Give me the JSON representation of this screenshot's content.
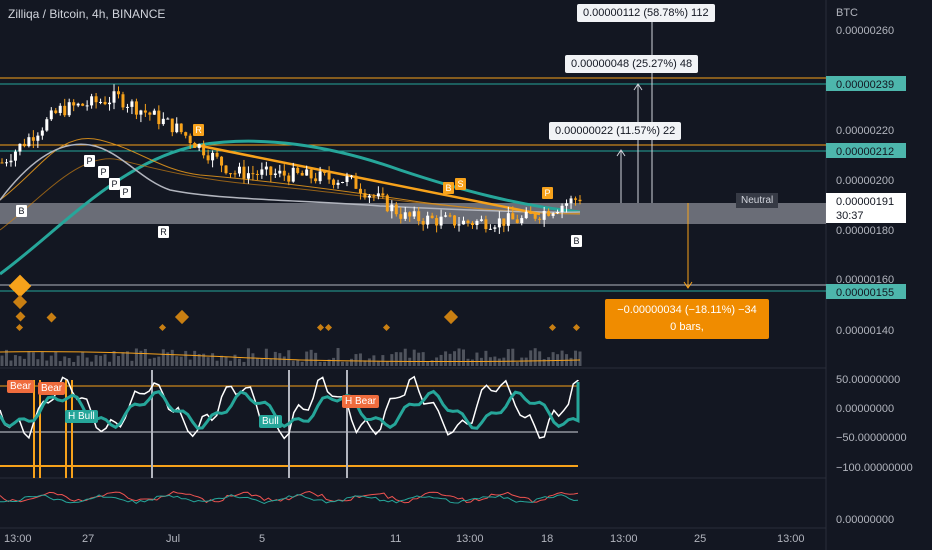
{
  "header": {
    "title": "Zilliqa / Bitcoin, 4h, BINANCE",
    "currency": "BTC"
  },
  "price_axis": [
    "0.00000260",
    "0.00000220",
    "0.00000200",
    "0.00000180",
    "0.00000160",
    "0.00000140"
  ],
  "price_tags": {
    "upper_line": "0.00000239",
    "mid_line": "0.00000212",
    "lower_line": "0.00000155",
    "last_price": "0.00000191",
    "countdown": "30:37"
  },
  "measure": {
    "up_112": "0.00000112 (58.78%) 112",
    "up_48": "0.00000048 (25.27%) 48",
    "up_22": "0.00000022 (11.57%) 22",
    "down_value": "−0.00000034 (−18.11%) −34",
    "down_bars": "0 bars,"
  },
  "neutral_label": "Neutral",
  "osc_axis": [
    "50.00000000",
    "0.00000000",
    "−50.00000000",
    "−100.00000000"
  ],
  "osc_labels": {
    "bear_1": "Bear",
    "bear_2": "Bear",
    "h_bull": "H Bull",
    "bull": "Bull",
    "h_bear": "H Bear"
  },
  "bottom_axis": [
    "0.00000000"
  ],
  "time_axis": [
    "13:00",
    "27",
    "Jul",
    "5",
    "11",
    "13:00",
    "18",
    "13:00",
    "25",
    "13:00"
  ],
  "badges": [
    "B",
    "P",
    "P",
    "P",
    "P",
    "R",
    "R",
    "B",
    "S",
    "P",
    "B"
  ],
  "colors": {
    "background": "#131722",
    "up": "#ffffff",
    "down": "#ffffff",
    "orange": "#f7a21b",
    "teal": "#26a69a",
    "teal_tag": "#4db6ac",
    "grey_band": "#b2b5be",
    "bear_label": "#ef6c3d",
    "bull_label": "#26a69a"
  },
  "chart_data": {
    "type": "line",
    "title": "Zilliqa / Bitcoin, 4h, BINANCE",
    "xlabel": "",
    "ylabel": "BTC",
    "ylim": [
      1.3e-06,
      2.7e-06
    ],
    "x": [
      "13:00",
      "27",
      "Jul",
      "5",
      "11",
      "13:00",
      "18",
      "13:00",
      "25",
      "13:00"
    ],
    "series": [
      {
        "values": [
          2.05e-06,
          2.26e-06,
          2.31e-06,
          2.19e-06,
          2.01e-06,
          2e-06,
          1.98e-06,
          1.83e-06,
          1.81e-06,
          1.82e-06,
          1.91e-06
        ]
      }
    ],
    "levels": [
      2.39e-06,
      2.12e-06,
      1.55e-06
    ],
    "last": 1.91e-06
  }
}
